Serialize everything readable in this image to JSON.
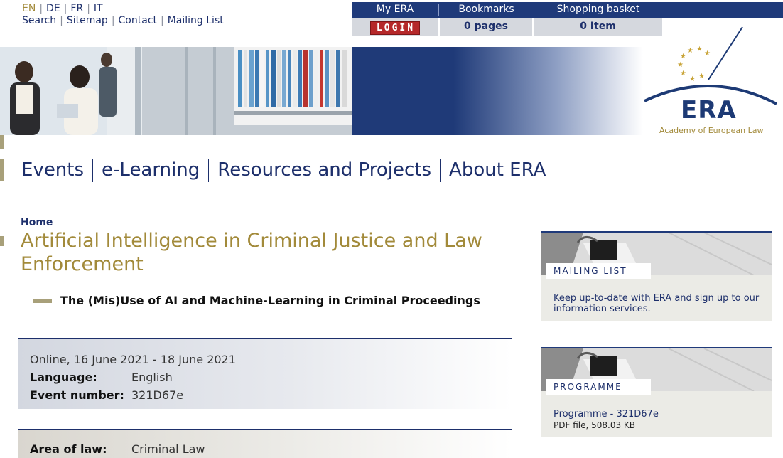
{
  "top_links": {
    "languages": [
      "EN",
      "DE",
      "FR",
      "IT"
    ],
    "active_language": "EN",
    "links": [
      "Search",
      "Sitemap",
      "Contact",
      "Mailing List"
    ]
  },
  "account_bar": {
    "my_era": {
      "label": "My ERA",
      "button": "LOGIN"
    },
    "bookmarks": {
      "label": "Bookmarks",
      "value": "0 pages"
    },
    "basket": {
      "label": "Shopping basket",
      "value": "0 Item"
    }
  },
  "logo": {
    "name": "ERA",
    "subtitle": "Academy of European Law"
  },
  "main_nav": [
    "Events",
    "e-Learning",
    "Resources and Projects",
    "About ERA"
  ],
  "breadcrumb": "Home",
  "page_title": "Artificial Intelligence in Criminal Justice and Law Enforcement",
  "subtitle": "The (Mis)Use of AI and Machine-Learning in Criminal Proceedings",
  "event": {
    "when": "Online, 16 June 2021 - 18 June 2021",
    "language_label": "Language:",
    "language": "English",
    "number_label": "Event number:",
    "number": "321D67e",
    "area_label": "Area of law:",
    "area": "Criminal Law"
  },
  "sidebar": {
    "mailing": {
      "tag": "MAILING LIST",
      "text": "Keep up-to-date with ERA and sign up to our information services."
    },
    "programme": {
      "tag": "PROGRAMME",
      "link": "Programme - 321D67e",
      "info": "PDF file, 508.03 KB"
    }
  },
  "colors": {
    "navy": "#1f3a7a",
    "gold": "#a28a3a",
    "login_red": "#b5282a"
  }
}
